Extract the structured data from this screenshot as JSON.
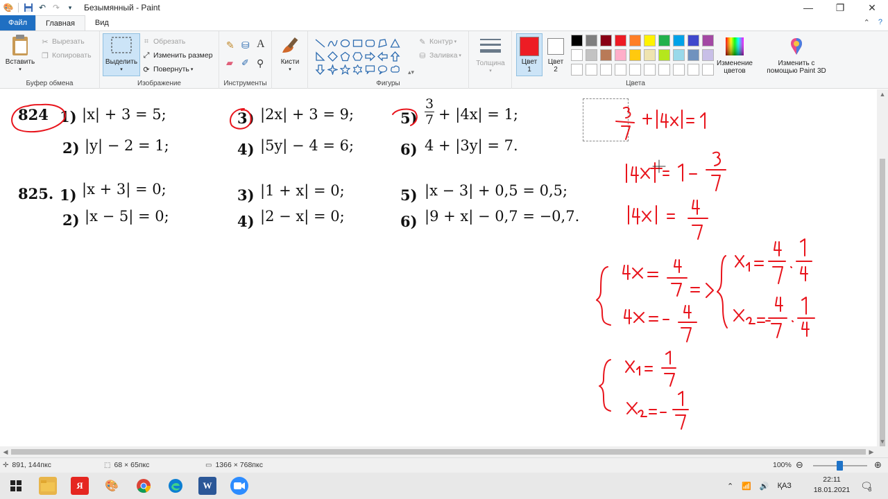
{
  "window": {
    "title": "Безымянный - Paint",
    "minimize_glyph": "—",
    "maximize_glyph": "❐",
    "close_glyph": "✕"
  },
  "menu": {
    "file": "Файл",
    "home": "Главная",
    "view": "Вид"
  },
  "ribbon": {
    "clipboard": {
      "label": "Буфер обмена",
      "paste": "Вставить",
      "cut": "Вырезать",
      "copy": "Копировать"
    },
    "image": {
      "label": "Изображение",
      "select": "Выделить",
      "crop": "Обрезать",
      "resize": "Изменить размер",
      "rotate": "Повернуть"
    },
    "tools": {
      "label": "Инструменты"
    },
    "brushes": {
      "label": "Кисти"
    },
    "shapes": {
      "label": "Фигуры",
      "outline": "Контур",
      "fill": "Заливка"
    },
    "thickness": {
      "label": "Толщина"
    },
    "colors": {
      "label": "Цвета",
      "color1": "Цвет 1",
      "color2": "Цвет 2",
      "edit_colors": "Изменение цветов",
      "paint3d": "Изменить с помощью Paint 3D",
      "color1_value": "#ed1c24",
      "color2_value": "#ffffff",
      "palette": [
        "#000000",
        "#7f7f7f",
        "#880015",
        "#ed1c24",
        "#ff7f27",
        "#fff200",
        "#22b14c",
        "#00a2e8",
        "#3f48cc",
        "#a349a4",
        "#ffffff",
        "#c3c3c3",
        "#b97a57",
        "#ffaec9",
        "#ffc90e",
        "#efe4b0",
        "#b5e61d",
        "#99d9ea",
        "#7092be",
        "#c8bfe7",
        "#ffffff",
        "#ffffff",
        "#ffffff",
        "#ffffff",
        "#ffffff",
        "#ffffff",
        "#ffffff",
        "#ffffff",
        "#ffffff",
        "#ffffff"
      ]
    }
  },
  "canvas": {
    "problems": {
      "n824": "824",
      "n825": "825.",
      "p824": [
        {
          "num": "1)",
          "expr": "|x| + 3 = 5;"
        },
        {
          "num": "2)",
          "expr": "|y| − 2 = 1;"
        },
        {
          "num": "3)",
          "expr": "|2x| + 3 = 9;"
        },
        {
          "num": "4)",
          "expr": "|5y| − 4 = 6;"
        },
        {
          "num": "5)",
          "expr": "+ |4x| = 1;"
        },
        {
          "num": "6)",
          "expr": "4 + |3y| = 7."
        }
      ],
      "p825": [
        {
          "num": "1)",
          "expr": "|x + 3| = 0;"
        },
        {
          "num": "2)",
          "expr": "|x − 5| = 0;"
        },
        {
          "num": "3)",
          "expr": "|1 + x| = 0;"
        },
        {
          "num": "4)",
          "expr": "|2 − x| = 0;"
        },
        {
          "num": "5)",
          "expr": "|x − 3| + 0,5 = 0,5;"
        },
        {
          "num": "6)",
          "expr": "|9 + x| − 0,7 = −0,7."
        }
      ],
      "frac_num": "3",
      "frac_den": "7"
    },
    "ink_color": "#e8141c"
  },
  "status": {
    "cursor_pos": "891, 144пкс",
    "selection_size": "68 × 65пкс",
    "image_size": "1366 × 768пкс",
    "zoom": "100%"
  },
  "taskbar": {
    "lang": "ҚАЗ",
    "time": "22:11",
    "date": "18.01.2021",
    "notifications": "3"
  }
}
